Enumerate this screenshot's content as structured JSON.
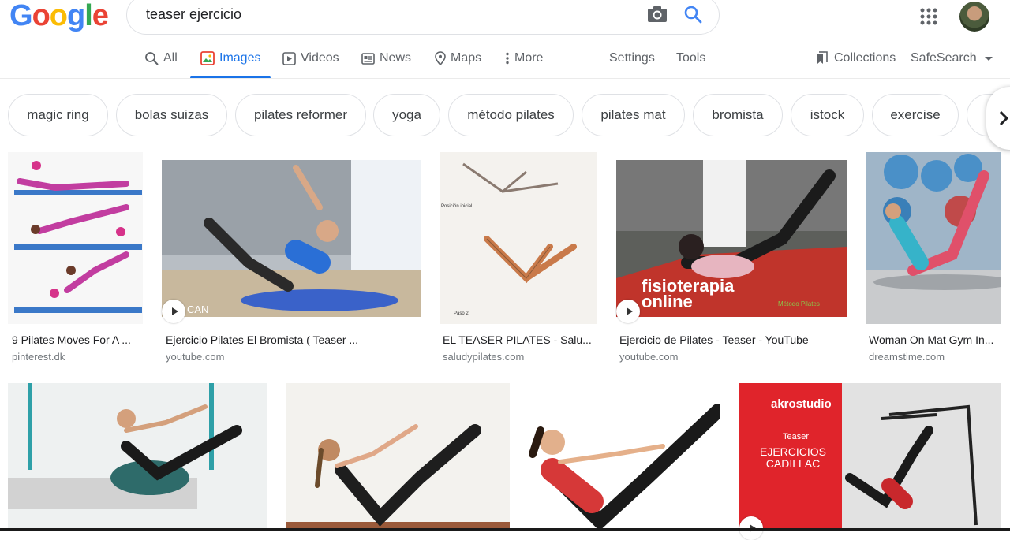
{
  "logo": {
    "letters": [
      "G",
      "o",
      "o",
      "g",
      "l",
      "e"
    ],
    "colors": [
      "#4285F4",
      "#EA4335",
      "#FBBC05",
      "#4285F4",
      "#34A853",
      "#EA4335"
    ]
  },
  "search": {
    "value": "teaser ejercicio"
  },
  "icons": {
    "camera": "camera-icon",
    "search": "search-icon",
    "apps": "apps-grid-icon"
  },
  "nav": {
    "tabs": [
      {
        "label": "All",
        "icon": "search-icon"
      },
      {
        "label": "Images",
        "icon": "image-icon"
      },
      {
        "label": "Videos",
        "icon": "video-icon"
      },
      {
        "label": "News",
        "icon": "news-icon"
      },
      {
        "label": "Maps",
        "icon": "map-pin-icon"
      },
      {
        "label": "More",
        "icon": "more-dots-icon"
      }
    ],
    "settings": "Settings",
    "tools": "Tools",
    "collections": "Collections",
    "safesearch": "SafeSearch"
  },
  "chips": [
    "magic ring",
    "bolas suizas",
    "pilates reformer",
    "yoga",
    "método pilates",
    "pilates mat",
    "bromista",
    "istock",
    "exercise"
  ],
  "results": [
    {
      "title": "9 Pilates Moves For A ...",
      "source": "pinterest.dk",
      "has_video": false
    },
    {
      "title": "Ejercicio Pilates El Bromista ( Teaser ...",
      "source": "youtube.com",
      "has_video": true,
      "overlay": "CAN"
    },
    {
      "title": "EL TEASER PILATES - Salu...",
      "source": "saludypilates.com",
      "has_video": false,
      "labels": [
        "Posición inicial.",
        "Paso 2."
      ]
    },
    {
      "title": "Ejercicio de Pilates - Teaser - YouTube",
      "source": "youtube.com",
      "has_video": true,
      "overlay": "fisioterapia online",
      "overlay2": "Método Pilates"
    },
    {
      "title": "Woman On Mat Gym In...",
      "source": "dreamstime.com",
      "has_video": false
    },
    {
      "title": "",
      "source": ""
    },
    {
      "title": "",
      "source": ""
    },
    {
      "title": "",
      "source": ""
    },
    {
      "title": "",
      "source": "",
      "has_video": true,
      "overlay": "akrostudio",
      "overlay_sub": "Teaser",
      "overlay_main": "EJERCICIOS CADILLAC"
    }
  ],
  "colors": {
    "accent": "#1a73e8",
    "text": "#202124",
    "muted": "#70757a"
  }
}
